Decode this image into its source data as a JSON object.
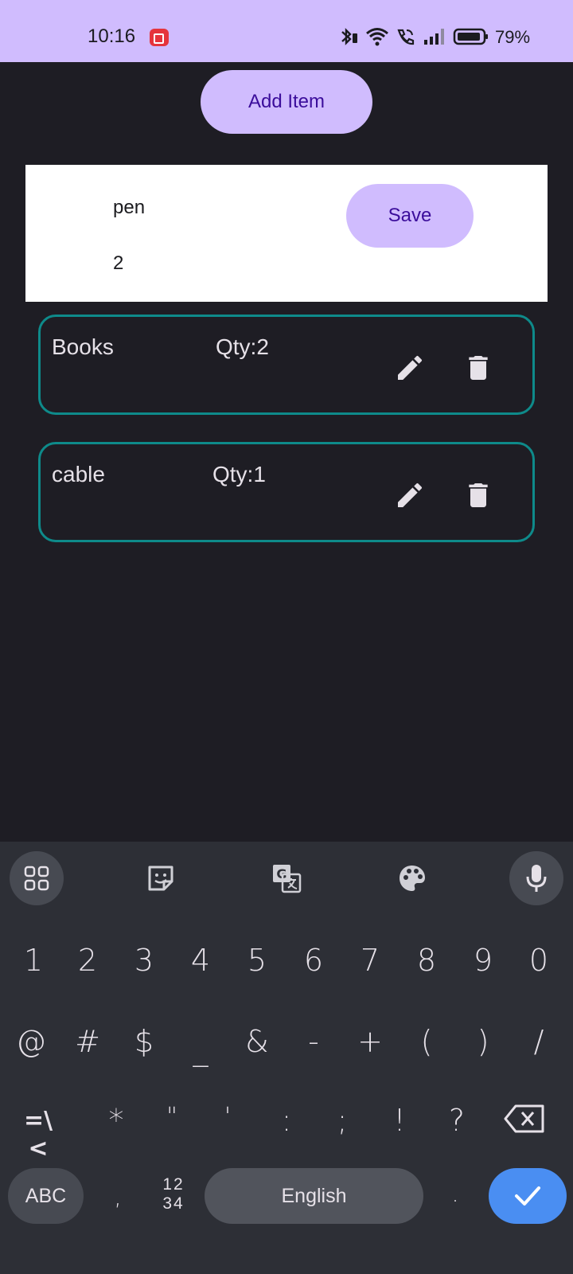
{
  "status_bar": {
    "time": "10:16",
    "battery": "79%",
    "icons": [
      "screen-record-icon",
      "bluetooth-icon",
      "wifi-icon",
      "volte-call-icon",
      "signal-icon",
      "battery-icon"
    ]
  },
  "toolbar": {
    "add_label": "Add Item"
  },
  "edit_form": {
    "name_value": "pen",
    "qty_value": "2",
    "save_label": "Save"
  },
  "items": [
    {
      "name": "Books",
      "qty": "Qty:2"
    },
    {
      "name": "cable",
      "qty": "Qty:1"
    }
  ],
  "keyboard": {
    "row1": [
      "1",
      "2",
      "3",
      "4",
      "5",
      "6",
      "7",
      "8",
      "9",
      "0"
    ],
    "row2": [
      "@",
      "#",
      "$",
      "_",
      "&",
      "-",
      "+",
      "(",
      ")",
      "/"
    ],
    "row3": [
      "=\\<",
      "*",
      "\"",
      "'",
      ":",
      ";",
      "!",
      "?"
    ],
    "abc_label": "ABC",
    "comma": ",",
    "numswitch_top": "12",
    "numswitch_bottom": "34",
    "space_label": "English",
    "period": "."
  },
  "colors": {
    "accent": "#d0bcfe",
    "accent_text": "#3b0d9b",
    "item_border": "#0e8a8a",
    "background": "#1e1d24",
    "enter_key": "#4a8ef2"
  }
}
